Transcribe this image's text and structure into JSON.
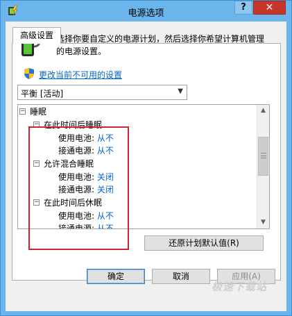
{
  "window": {
    "title": "电源选项"
  },
  "titlebar": {
    "help_label": "?",
    "close_label": "✕"
  },
  "tab": {
    "label": "高级设置"
  },
  "description": "选择你要自定义的电源计划，然后选择你希望计算机管理的电源设置。",
  "change_settings_link": "更改当前不可用的设置",
  "plan_select": {
    "value": "平衡 [活动]"
  },
  "tree": {
    "sleep": {
      "label": "睡眠"
    },
    "sleep_after": {
      "label": "在此时间后睡眠",
      "battery": {
        "label": "使用电池:",
        "value": "从不"
      },
      "plugged": {
        "label": "接通电源:",
        "value": "从不"
      }
    },
    "hybrid_sleep": {
      "label": "允许混合睡眠",
      "battery": {
        "label": "使用电池:",
        "value": "关闭"
      },
      "plugged": {
        "label": "接通电源:",
        "value": "关闭"
      }
    },
    "hibernate_after": {
      "label": "在此时间后休眠",
      "battery": {
        "label": "使用电池:",
        "value": "从不"
      },
      "plugged": {
        "label": "接通电源:",
        "value": "从不"
      }
    }
  },
  "buttons": {
    "restore_defaults": "还原计划默认值(R)",
    "ok": "确定",
    "cancel": "取消",
    "apply": "应用(A)"
  },
  "watermark": "极速下载站",
  "colors": {
    "accent": "#0066cc",
    "highlight": "#d4232a",
    "titlebar": "#6cb4ec",
    "close": "#c7362b"
  }
}
